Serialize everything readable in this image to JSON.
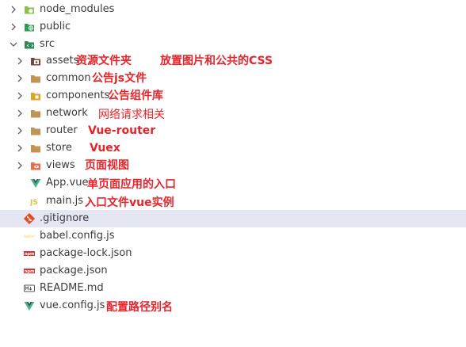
{
  "tree": {
    "node_modules": {
      "label": "node_modules"
    },
    "public": {
      "label": "public"
    },
    "src": {
      "label": "src"
    },
    "assets": {
      "label": "assets",
      "note": "资源文件夹",
      "note2": "放置图片和公共的CSS"
    },
    "common": {
      "label": "common",
      "note": "公告js文件"
    },
    "components": {
      "label": "components",
      "note": "公告组件库"
    },
    "network": {
      "label": "network",
      "note": "网络请求相关"
    },
    "router": {
      "label": "router",
      "note": "Vue-router"
    },
    "store": {
      "label": "store",
      "note": "Vuex"
    },
    "views": {
      "label": "views",
      "note": "页面视图"
    },
    "app_vue": {
      "label": "App.vue",
      "note": "单页面应用的入口"
    },
    "main_js": {
      "label": "main.js",
      "note": "入口文件vue实例"
    },
    "gitignore": {
      "label": ".gitignore"
    },
    "babel_config": {
      "label": "babel.config.js"
    },
    "package_lock": {
      "label": "package-lock.json"
    },
    "package_json": {
      "label": "package.json"
    },
    "readme": {
      "label": "README.md"
    },
    "vue_config": {
      "label": "vue.config.js",
      "note": "配置路径别名"
    }
  },
  "icons": {
    "node_modules": "nodejs-folder-icon",
    "public": "public-folder-icon",
    "src": "src-folder-icon",
    "assets": "assets-folder-icon",
    "folder": "folder-icon",
    "components": "components-folder-icon",
    "views": "views-folder-icon",
    "vue": "vue-icon",
    "js": "js-icon",
    "git": "git-icon",
    "babel": "babel-icon",
    "npm": "npm-icon",
    "markdown": "markdown-icon"
  },
  "colors": {
    "annotation": "#e8242b",
    "selection": "#e4e6f1",
    "folder": "#c09553",
    "vue": "#41b883",
    "js": "#cbcb41"
  }
}
